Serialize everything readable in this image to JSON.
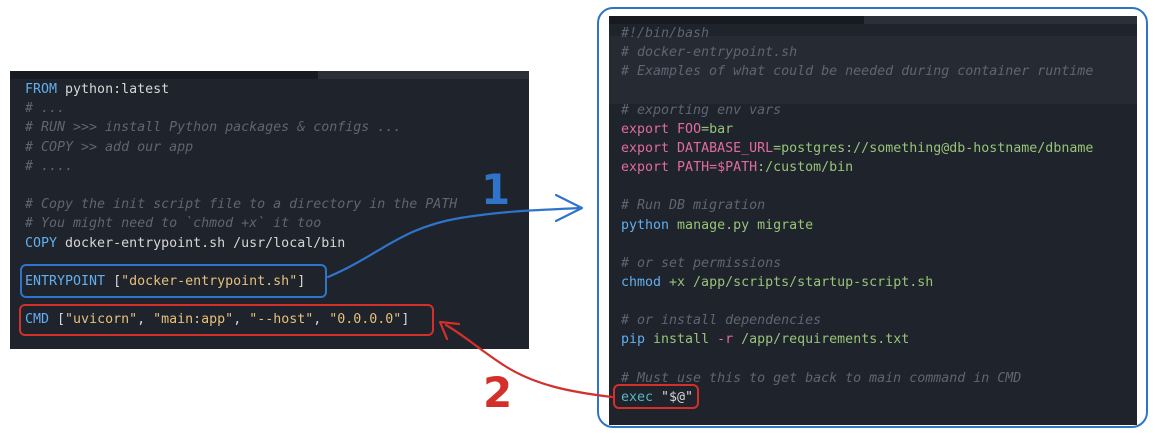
{
  "left_code": [
    [
      {
        "t": "FROM",
        "c": "kw"
      },
      {
        "t": " python:latest",
        "c": "plain"
      }
    ],
    [
      {
        "t": "# ...",
        "c": "comment"
      }
    ],
    [
      {
        "t": "# RUN >>> install Python packages & configs ...",
        "c": "comment"
      }
    ],
    [
      {
        "t": "# COPY >> add our app",
        "c": "comment"
      }
    ],
    [
      {
        "t": "# ....",
        "c": "comment"
      }
    ],
    [],
    [
      {
        "t": "# Copy the init script file to a directory in the PATH",
        "c": "comment"
      }
    ],
    [
      {
        "t": "# You might need to `chmod +x` it too",
        "c": "comment"
      }
    ],
    [
      {
        "t": "COPY",
        "c": "kw"
      },
      {
        "t": " docker-entrypoint.sh /usr/local/bin",
        "c": "plain"
      }
    ],
    [],
    [
      {
        "t": "ENTRYPOINT",
        "c": "kw"
      },
      {
        "t": " [",
        "c": "plain"
      },
      {
        "t": "\"docker-entrypoint.sh\"",
        "c": "str"
      },
      {
        "t": "]",
        "c": "plain"
      }
    ],
    [],
    [
      {
        "t": "CMD",
        "c": "kw"
      },
      {
        "t": " [",
        "c": "plain"
      },
      {
        "t": "\"uvicorn\"",
        "c": "str"
      },
      {
        "t": ", ",
        "c": "plain"
      },
      {
        "t": "\"main:app\"",
        "c": "str"
      },
      {
        "t": ", ",
        "c": "plain"
      },
      {
        "t": "\"--host\"",
        "c": "str"
      },
      {
        "t": ", ",
        "c": "plain"
      },
      {
        "t": "\"0.0.0.0\"",
        "c": "str"
      },
      {
        "t": "]",
        "c": "plain"
      }
    ]
  ],
  "right_code": [
    [
      {
        "t": "#!/bin/bash",
        "c": "comment"
      }
    ],
    [
      {
        "t": "# docker-entrypoint.sh",
        "c": "comment"
      }
    ],
    [
      {
        "t": "# Examples of what could be needed during container runtime",
        "c": "comment"
      }
    ],
    [],
    [
      {
        "t": "# exporting env vars",
        "c": "comment"
      }
    ],
    [
      {
        "t": "export",
        "c": "var"
      },
      {
        "t": " FOO",
        "c": "var"
      },
      {
        "t": "=bar",
        "c": "green"
      }
    ],
    [
      {
        "t": "export",
        "c": "var"
      },
      {
        "t": " DATABASE_URL",
        "c": "var"
      },
      {
        "t": "=postgres://something@db-hostname/dbname",
        "c": "green"
      }
    ],
    [
      {
        "t": "export",
        "c": "var"
      },
      {
        "t": " PATH",
        "c": "var"
      },
      {
        "t": "=$PATH",
        "c": "var"
      },
      {
        "t": ":/custom/bin",
        "c": "green"
      }
    ],
    [],
    [
      {
        "t": "# Run DB migration",
        "c": "comment"
      }
    ],
    [
      {
        "t": "python",
        "c": "kw"
      },
      {
        "t": " manage.py migrate",
        "c": "green"
      }
    ],
    [],
    [
      {
        "t": "# or set permissions",
        "c": "comment"
      }
    ],
    [
      {
        "t": "chmod",
        "c": "kw"
      },
      {
        "t": " +x /app/scripts/startup-script.sh",
        "c": "green"
      }
    ],
    [],
    [
      {
        "t": "# or install dependencies",
        "c": "comment"
      }
    ],
    [
      {
        "t": "pip",
        "c": "kw"
      },
      {
        "t": " install ",
        "c": "green"
      },
      {
        "t": "-r",
        "c": "var"
      },
      {
        "t": " /app/requirements.txt",
        "c": "green"
      }
    ],
    [],
    [
      {
        "t": "# Must use this to get back to main command in CMD",
        "c": "comment"
      }
    ],
    [
      {
        "t": "exec",
        "c": "cyan"
      },
      {
        "t": " \"$@\"",
        "c": "plain"
      }
    ]
  ],
  "annotations": {
    "label_1": "1",
    "label_2": "2",
    "blue": "#2f74c8",
    "red": "#d3302b"
  }
}
